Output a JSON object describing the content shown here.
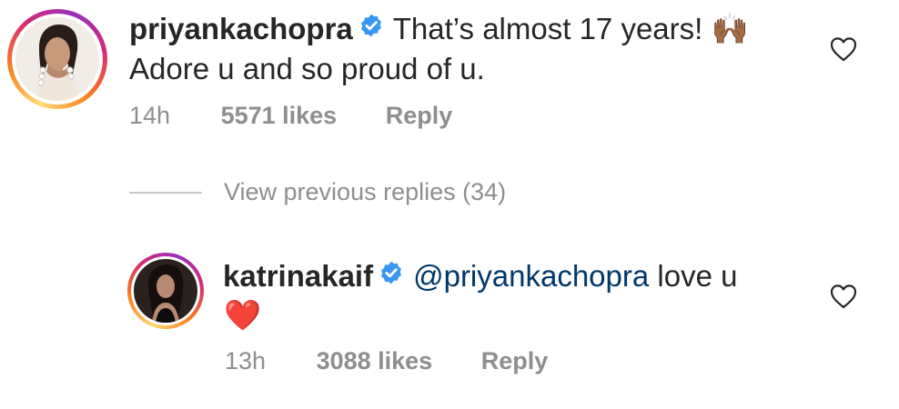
{
  "comments": [
    {
      "username": "priyankachopra",
      "verified": true,
      "text_line1": "That’s almost 17 years!",
      "emoji_line1": "🙌🏾",
      "text_line2": "Adore u and so proud of u.",
      "time": "14h",
      "likes": "5571 likes",
      "reply_label": "Reply"
    },
    {
      "username": "katrinakaif",
      "verified": true,
      "mention": "@priyankachopra",
      "text_line1": "love u",
      "emoji_line2": "❤️",
      "time": "13h",
      "likes": "3088 likes",
      "reply_label": "Reply"
    }
  ],
  "view_previous": "View previous replies (34)",
  "colors": {
    "verified_badge": "#3897f0",
    "mention": "#00376b",
    "meta_text": "#8e8e8e",
    "heart_emoji": "#e0245e"
  },
  "icons": {
    "like": "heart-outline-icon",
    "verified": "verified-badge-icon"
  }
}
